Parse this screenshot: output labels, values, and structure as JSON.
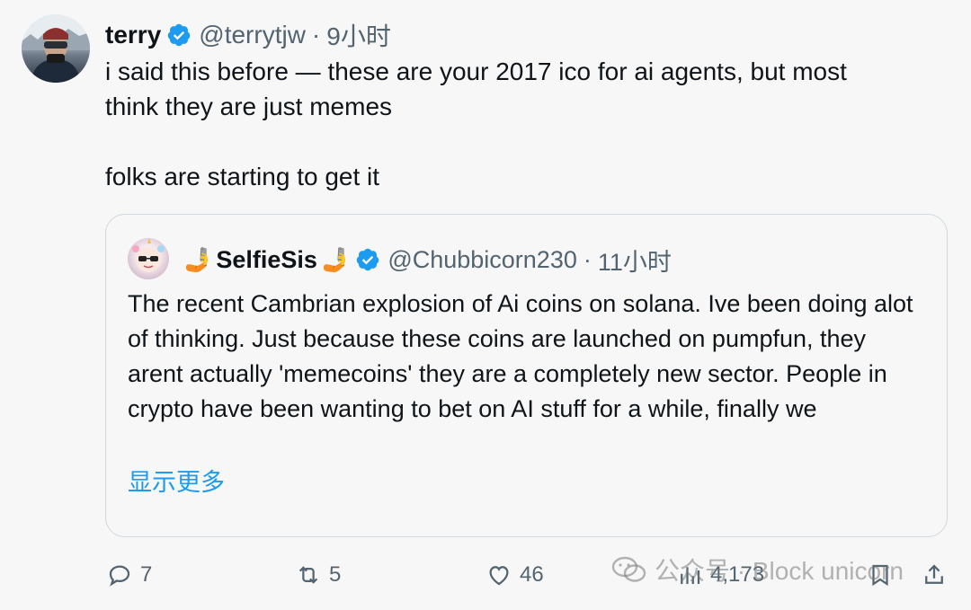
{
  "tweet": {
    "author_name": "terry",
    "handle": "@terrytjw",
    "time": "9小时",
    "text": "i said this before — these are your 2017 ico for ai agents, but most\nthink they are just memes\n\nfolks are starting to get it"
  },
  "quote": {
    "author_prefix": "🤳",
    "author_name": "SelfieSis",
    "author_suffix": "🤳",
    "handle": "@Chubbicorn230",
    "time": "11小时",
    "text": "The recent Cambrian explosion of Ai coins on solana. Ive been doing alot of thinking. Just because these coins are launched on pumpfun, they arent actually 'memecoins' they are a completely new sector. People in crypto have been wanting to bet on AI stuff for a while, finally we",
    "show_more": "显示更多"
  },
  "actions": {
    "replies": "7",
    "retweets": "5",
    "likes": "46",
    "views": "4,173"
  },
  "watermark": "公众号 · Block unicorn",
  "colors": {
    "verified": "#1d9bf0",
    "link": "#1d9bf0",
    "muted": "#536471"
  }
}
